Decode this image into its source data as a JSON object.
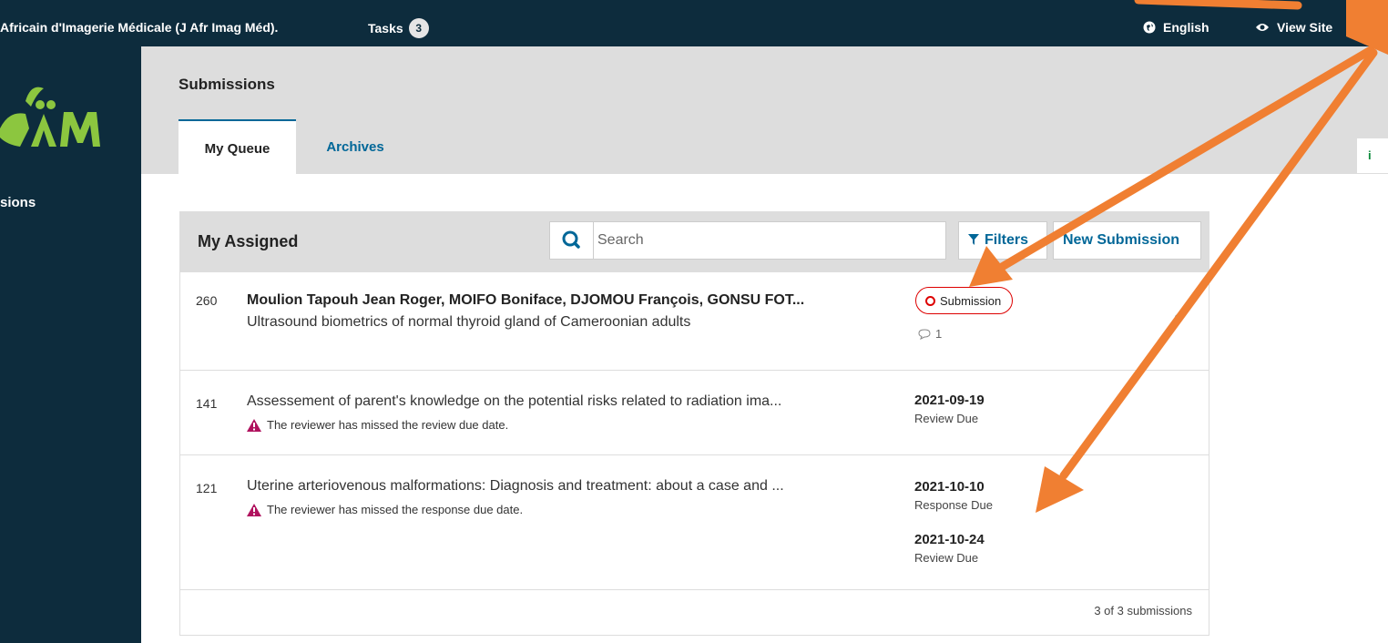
{
  "topbar": {
    "journal": "Africain d'Imagerie Médicale (J Afr Imag Méd).",
    "tasks_label": "Tasks",
    "tasks_count": "3",
    "language": "English",
    "view_site": "View Site"
  },
  "sidebar": {
    "nav_item": "sions"
  },
  "page": {
    "title": "Submissions",
    "tabs": [
      {
        "label": "My Queue",
        "active": true
      },
      {
        "label": "Archives",
        "active": false
      }
    ]
  },
  "side_info_glyph": "i",
  "panel": {
    "title": "My Assigned",
    "search_placeholder": "Search",
    "filters_label": "Filters",
    "new_submission_label": "New Submission",
    "count_text": "3 of 3 submissions"
  },
  "submissions": [
    {
      "id": "260",
      "authors": "Moulion Tapouh Jean Roger, MOIFO Boniface, DJOMOU François, GONSU FOT...",
      "title": "Ultrasound biometrics of normal thyroid gland of Cameroonian adults",
      "stage": "Submission",
      "comments": "1"
    },
    {
      "id": "141",
      "title": "Assessement of parent's knowledge on the potential risks related to radiation ima...",
      "warning": "The reviewer has missed the review due date.",
      "dates": [
        {
          "date": "2021-09-19",
          "label": "Review Due"
        }
      ]
    },
    {
      "id": "121",
      "title": "Uterine arteriovenous malformations: Diagnosis and treatment: about a case and ...",
      "warning": "The reviewer has missed the response due date.",
      "dates": [
        {
          "date": "2021-10-10",
          "label": "Response Due"
        },
        {
          "date": "2021-10-24",
          "label": "Review Due"
        }
      ]
    }
  ],
  "colors": {
    "dark_navy": "#0d2c3d",
    "link_blue": "#006798",
    "header_gray": "#dddddd",
    "stage_red": "#dd0000",
    "warning_magenta": "#b0125e",
    "annotation_orange": "#f07f32"
  }
}
